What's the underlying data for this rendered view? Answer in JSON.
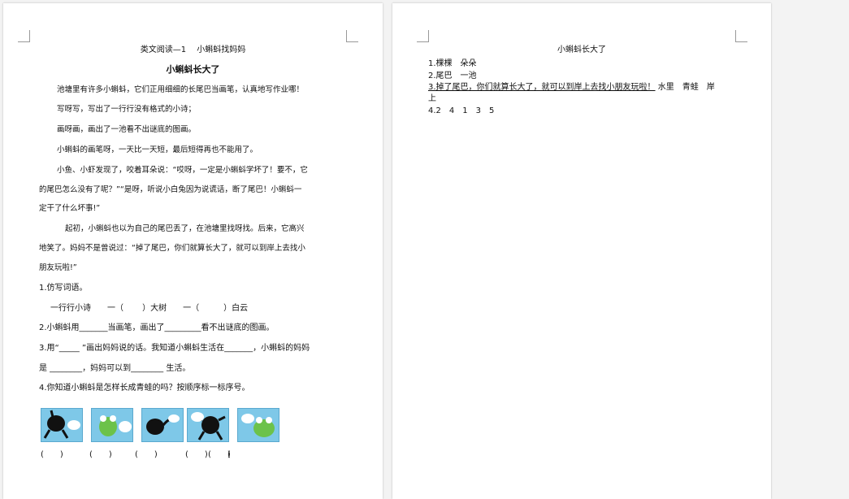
{
  "left": {
    "header": "类文阅读—1　 小蝌蚪找妈妈",
    "title": "小蝌蚪长大了",
    "lines": [
      "池塘里有许多小蝌蚪，它们正用细细的长尾巴当画笔，认真地写作业哪！",
      "写呀写，写出了一行行没有格式的小诗；",
      "画呀画，画出了一池看不出谜底的图画。",
      "小蝌蚪的画笔呀，一天比一天短，最后短得再也不能用了。",
      "小鱼、小虾发现了，咬着耳朵说：“哎呀，一定是小蝌蚪学坏了！要不，它",
      "的尾巴怎么没有了呢？”“是呀，听说小白兔因为说谎话，断了尾巴！小蝌蚪一",
      "定干了什么坏事!”",
      "起初，小蝌蚪也以为自己的尾巴丢了，在池塘里找呀找。后来，它高兴",
      "地笑了。妈妈不是曾说过：“掉了尾巴，你们就算长大了，就可以到岸上去找小",
      "朋友玩啦!”"
    ],
    "q1": "1.仿写词语。",
    "q1a": "一行行小诗　　一（　　 ）大树　　一（　　　）白云",
    "q2": "2.小蝌蚪用_______当画笔，画出了_________看不出谜底的图画。",
    "q3": "3.用“_____ ”画出妈妈说的话。我知道小蝌蚪生活在_______，小蝌蚪的妈妈",
    "q3b": "是 ________，妈妈可以到________ 生活。",
    "q4": "4.你知道小蝌蚪是怎样长成青蛙的吗？按顺序标一标序号。",
    "parens": [
      "(　　)",
      "(　　)",
      "(　　)",
      "(　　)",
      "(　　)",
      "("
    ]
  },
  "right": {
    "title": "小蝌蚪长大了",
    "a1": "1.棵棵　朵朵",
    "a2": "2.尾巴　一池",
    "a3_u": "3.掉了尾巴，你们就算长大了，就可以到岸上去找小朋友玩啦！",
    "a3_rest": "水里　青蛙　岸",
    "a3_cont": "上",
    "a4": "4.2　4　1　3　5"
  },
  "colors": {
    "page": "#ffffff",
    "background": "#f3f3f3",
    "picture_bg": "#7ec8e8"
  }
}
